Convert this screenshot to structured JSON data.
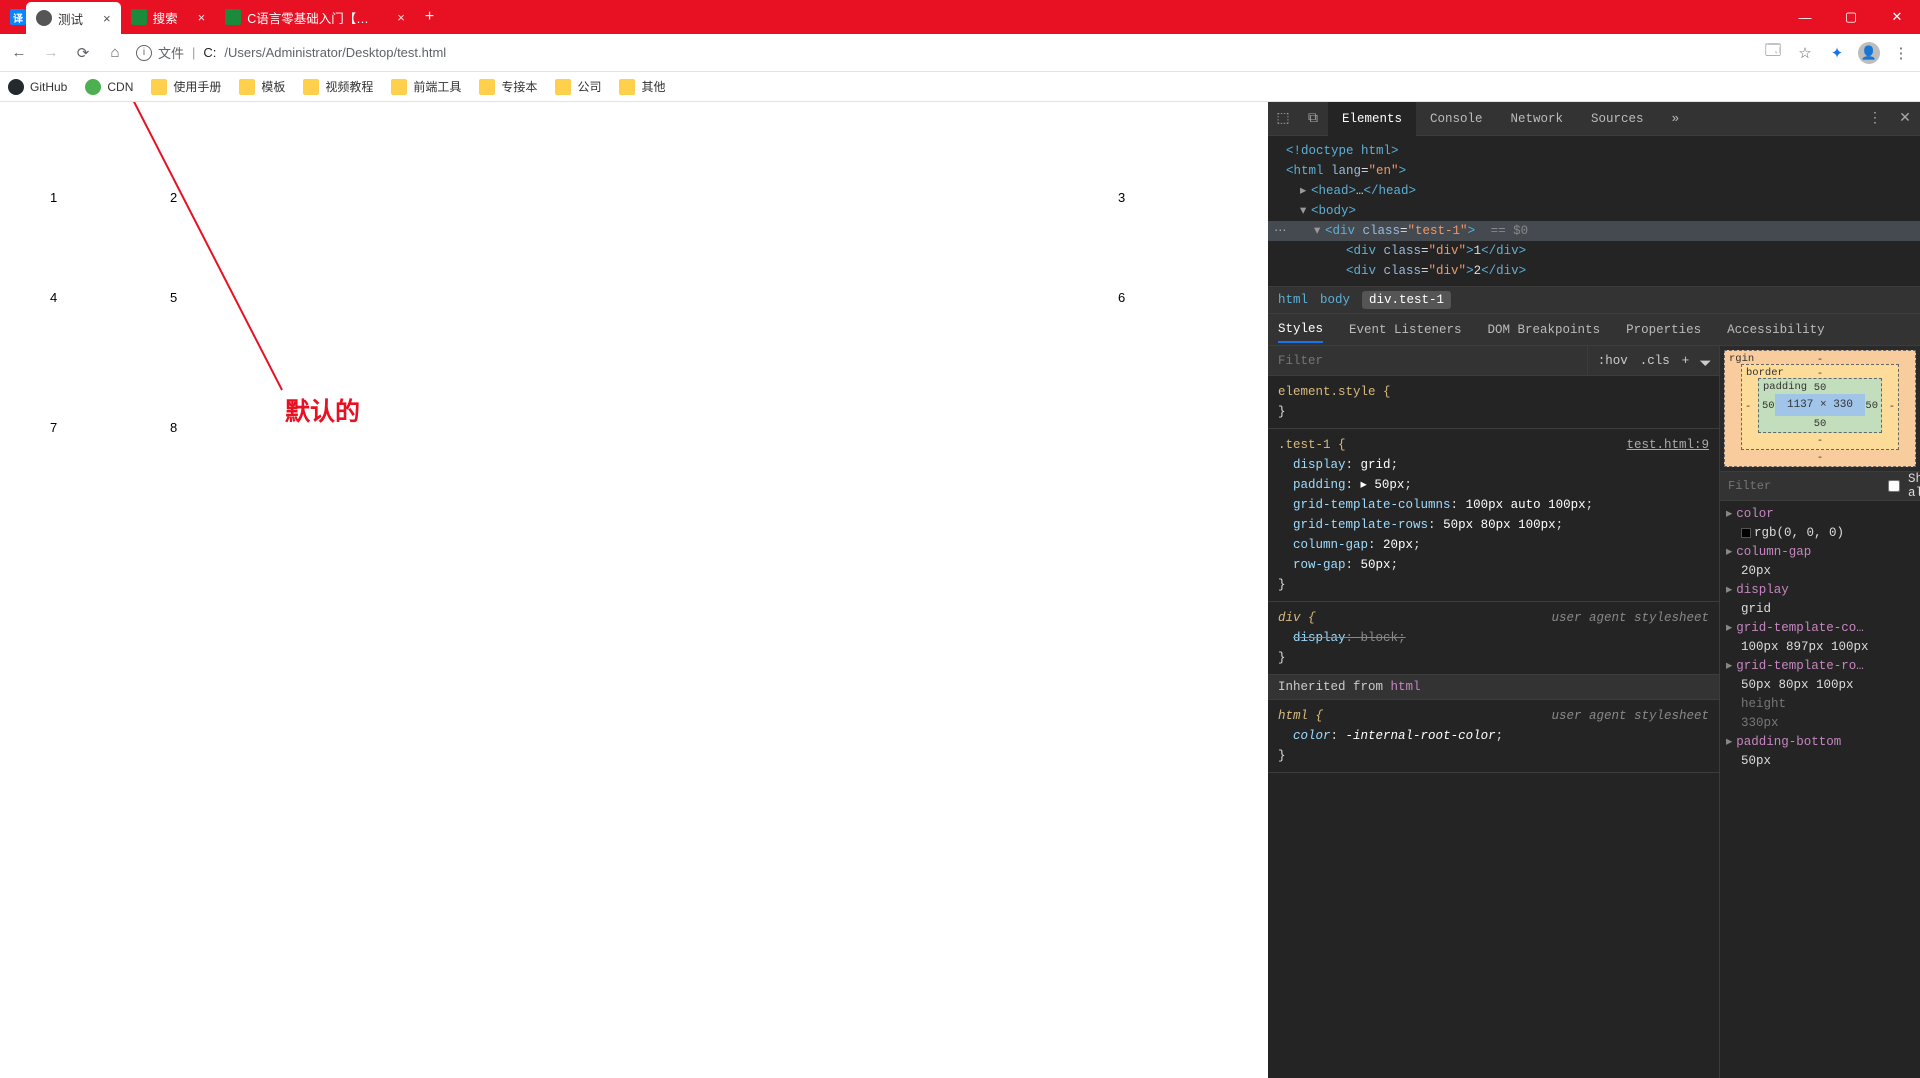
{
  "tabs": [
    {
      "title": "测试",
      "active": true
    },
    {
      "title": "搜索",
      "active": false
    },
    {
      "title": "C语言零基础入门【基础教程】-",
      "active": false
    }
  ],
  "win": {
    "min": "—",
    "max": "▢",
    "close": "✕"
  },
  "address": {
    "info_label": "文件",
    "url_prefix": "C:",
    "url_path": "/Users/Administrator/Desktop/test.html"
  },
  "bookmarks": [
    "GitHub",
    "CDN",
    "使用手册",
    "模板",
    "视频教程",
    "前端工具",
    "专接本",
    "公司",
    "其他"
  ],
  "grid_cells": [
    "1",
    "2",
    "3",
    "4",
    "5",
    "6",
    "7",
    "8"
  ],
  "annotation": "默认的",
  "devtools": {
    "tabs": [
      "Elements",
      "Console",
      "Network",
      "Sources"
    ],
    "more": "»",
    "tree": {
      "doctype": "<!doctype html>",
      "html_open": "<html lang=\"en\">",
      "head": "<head>…</head>",
      "body_open": "<body>",
      "sel_open": "<div class=\"test-1\">",
      "sel_suffix": " == $0",
      "child1": "<div class=\"div\">1</div>",
      "child2": "<div class=\"div\">2</div>"
    },
    "crumbs": [
      "html",
      "body",
      "div.test-1"
    ],
    "panels": [
      "Styles",
      "Event Listeners",
      "DOM Breakpoints",
      "Properties",
      "Accessibility"
    ],
    "filter_placeholder": "Filter",
    "hov": ":hov",
    "cls": ".cls",
    "plus": "+",
    "styles": {
      "element_style": "element.style {",
      "test1_sel": ".test-1 {",
      "test1_link": "test.html:9",
      "test1_rules": [
        [
          "display",
          "grid"
        ],
        [
          "padding",
          "▸ 50px"
        ],
        [
          "grid-template-columns",
          "100px auto 100px"
        ],
        [
          "grid-template-rows",
          "50px 80px 100px"
        ],
        [
          "column-gap",
          "20px"
        ],
        [
          "row-gap",
          "50px"
        ]
      ],
      "div_sel": "div {",
      "div_rule_prop": "display",
      "div_rule_val": "block",
      "uas": "user agent stylesheet",
      "inherited": "Inherited from ",
      "inherited_kw": "html",
      "html_sel": "html {",
      "html_rule_prop": "color",
      "html_rule_val": "-internal-root-color"
    },
    "boxmodel": {
      "margin_label": "rgin",
      "border_label": "border",
      "padding_label": "padding",
      "padding": "50",
      "content": "1137 × 330",
      "dash": "-"
    },
    "computed": {
      "filter_placeholder": "Filter",
      "show_all": "Show all",
      "props": [
        {
          "p": "color",
          "v": "rgb(0, 0, 0)",
          "swatch": true
        },
        {
          "p": "column-gap",
          "v": "20px"
        },
        {
          "p": "display",
          "v": "grid"
        },
        {
          "p": "grid-template-co…",
          "v": "100px 897px 100px"
        },
        {
          "p": "grid-template-ro…",
          "v": "50px 80px 100px"
        },
        {
          "p": "height",
          "v": "330px",
          "dim": true
        },
        {
          "p": "padding-bottom",
          "v": "50px"
        }
      ]
    }
  }
}
